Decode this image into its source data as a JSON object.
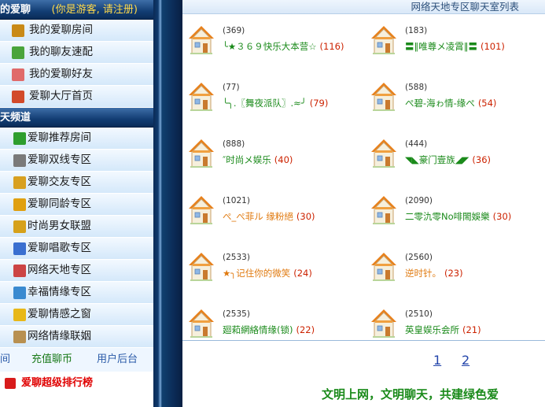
{
  "sidebar": {
    "my_header": {
      "title": "的爱聊",
      "subtitle": "(你是游客, 请注册)"
    },
    "my_items": [
      {
        "label": "我的爱聊房间",
        "icon": "book-icon",
        "color": "#c98a17"
      },
      {
        "label": "我的聊友速配",
        "icon": "puzzle-icon",
        "color": "#4aa43b"
      },
      {
        "label": "我的爱聊好友",
        "icon": "envelope-heart-icon",
        "color": "#e06a6a"
      },
      {
        "label": "爱聊大厅首页",
        "icon": "home-icon",
        "color": "#d24a2a"
      }
    ],
    "channel_header": {
      "title": "天频道"
    },
    "channel_items": [
      {
        "label": "爱聊推荐房间",
        "icon": "checkmark-icon",
        "color": "#2e9e2e"
      },
      {
        "label": "爱聊双线专区",
        "icon": "grid-icon",
        "color": "#7a7a7a"
      },
      {
        "label": "爱聊交友专区",
        "icon": "users-icon",
        "color": "#d8a020"
      },
      {
        "label": "爱聊同龄专区",
        "icon": "people-icon",
        "color": "#e0a010"
      },
      {
        "label": "时尚男女联盟",
        "icon": "card-icon",
        "color": "#d6a11a"
      },
      {
        "label": "爱聊唱歌专区",
        "icon": "music-note-icon",
        "color": "#3a6fd0"
      },
      {
        "label": "网络天地专区",
        "icon": "people-pair-icon",
        "color": "#cc4444"
      },
      {
        "label": "幸福情缘专区",
        "icon": "certificate-icon",
        "color": "#3a8ad0"
      },
      {
        "label": "爱聊情感之窗",
        "icon": "lightning-icon",
        "color": "#e8b818"
      },
      {
        "label": "网络情缘联姻",
        "icon": "wand-icon",
        "color": "#b89050"
      }
    ],
    "links": [
      "间",
      "充值聊币",
      "用户后台"
    ],
    "ranking_label": "爱聊超级排行榜"
  },
  "main": {
    "header_title": "网络天地专区聊天室列表",
    "rooms": [
      {
        "count": "(369)",
        "name": "╰★３６９快乐大本营☆",
        "occupancy": "(116)",
        "color": "#1a8a1a"
      },
      {
        "count": "(183)",
        "name": "〓‖唯尊メ凌霄‖〓",
        "occupancy": "(101)",
        "color": "#1a8a1a"
      },
      {
        "count": "(77)",
        "name": "╰╮.〖舞夜派队〗.≈╯",
        "occupancy": "(79)",
        "color": "#1a8a1a"
      },
      {
        "count": "(588)",
        "name": "ぺ碧-海ゎ情-缘ぺ",
        "occupancy": "(54)",
        "color": "#1a8a1a"
      },
      {
        "count": "(888)",
        "name": "″时尚メ娱乐",
        "occupancy": "(40)",
        "color": "#1a8a1a"
      },
      {
        "count": "(444)",
        "name": "◥◣豪门壹族◢◤",
        "occupancy": "(36)",
        "color": "#1a8a1a"
      },
      {
        "count": "(1021)",
        "name": "ぺ_ぺ菲ル 缘粉絕",
        "occupancy": "(30)",
        "color": "#e07a10"
      },
      {
        "count": "(2090)",
        "name": "二零氿零No啡閙娛樂",
        "occupancy": "(30)",
        "color": "#1a8a1a"
      },
      {
        "count": "(2533)",
        "name": "★╮记住你的微笑",
        "occupancy": "(24)",
        "color": "#e07a10"
      },
      {
        "count": "(2560)",
        "name": "逆时针。",
        "occupancy": "(23)",
        "color": "#e07a10"
      },
      {
        "count": "(2535)",
        "name": "廻萂網絡情缘(锁)",
        "occupancy": "(22)",
        "color": "#1a8a1a"
      },
      {
        "count": "(2510)",
        "name": "英皇娱乐会所",
        "occupancy": "(21)",
        "color": "#1a8a1a"
      }
    ],
    "pages": [
      "1",
      "2"
    ],
    "footer_message": "文明上网，文明聊天，共建绿色爱"
  }
}
